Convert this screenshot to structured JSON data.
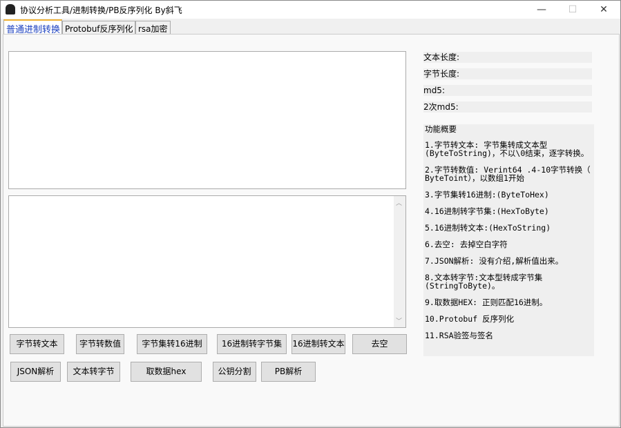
{
  "window": {
    "title": "协议分析工具/进制转换/PB反序列化  By斜飞",
    "minimize": "—",
    "maximize": "☐",
    "close": "✕"
  },
  "tabs": [
    {
      "label": "普通进制转换"
    },
    {
      "label": "Protobuf反序列化"
    },
    {
      "label": "rsa加密"
    }
  ],
  "inputs": {
    "top_value": "",
    "bottom_value": ""
  },
  "stats": {
    "text_length": "文本长度:",
    "byte_length": "字节长度:",
    "md5": "md5:",
    "md5_twice": "2次md5:"
  },
  "info": {
    "title": "功能概要",
    "items": [
      "1.字节转文本: 字节集转成文本型\n(ByteToString)，不以\\0结束，逐字转换。",
      "2.字节转数值: Verint64 .4-10字节转换（\nByteToint），以数组1开始",
      "3.字节集转16进制:(ByteToHex)",
      "4.16进制转字节集:(HexToByte)",
      "5.16进制转文本:(HexToString)",
      "6.去空: 去掉空白字符",
      "7.JSON解析: 没有介绍,解析值出来。",
      "8.文本转字节:文本型转成字节集\n(StringToByte)。",
      "9.取数据HEX: 正则匹配16进制。",
      "10.Protobuf 反序列化",
      "11.RSA验签与签名"
    ]
  },
  "buttons": {
    "row1": [
      "字节转文本",
      "字节转数值",
      "字节集转16进制",
      "16进制转字节集",
      "16进制转文本",
      "去空"
    ],
    "row2": [
      "JSON解析",
      "文本转字节",
      "取数据hex",
      "公钥分割",
      "PB解析"
    ]
  }
}
